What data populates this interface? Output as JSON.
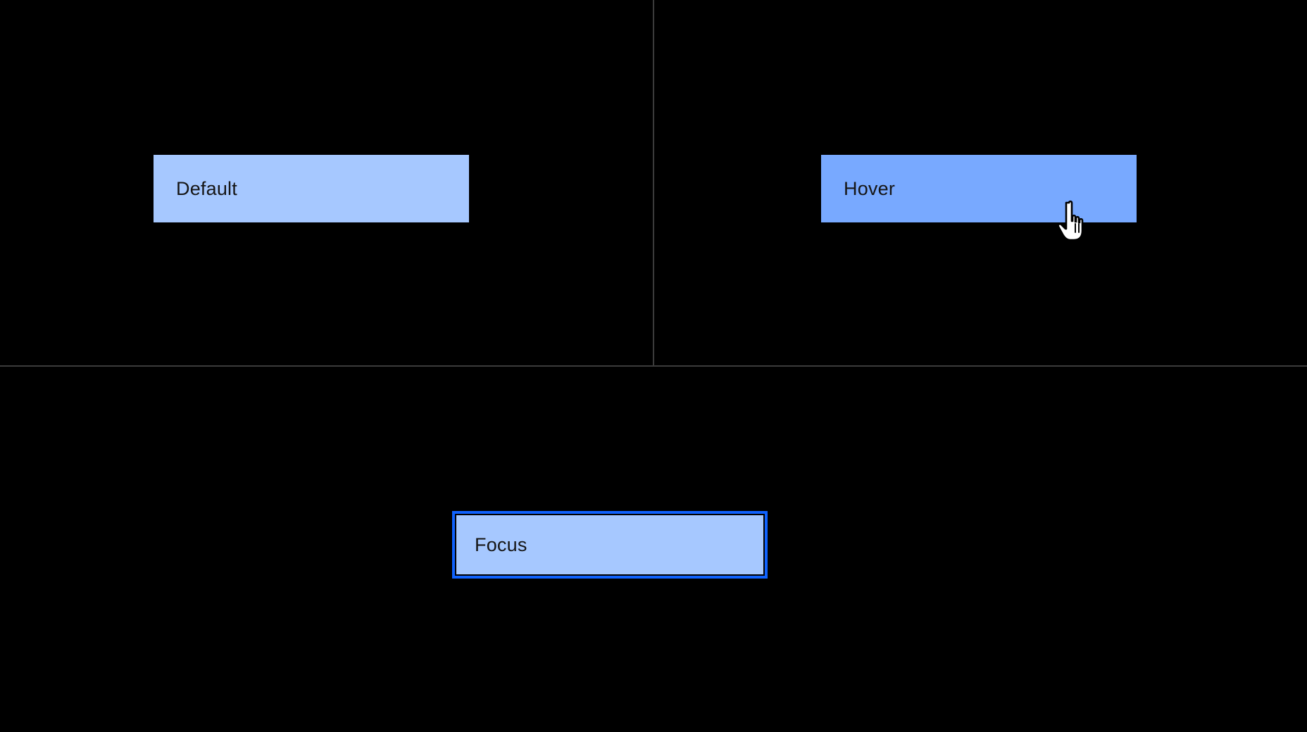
{
  "buttons": {
    "default_label": "Default",
    "hover_label": "Hover",
    "focus_label": "Focus"
  },
  "colors": {
    "background": "#000000",
    "divider": "#3b3b3b",
    "button_default": "#a6c8ff",
    "button_hover": "#78a9ff",
    "focus_ring": "#0f62fe",
    "text": "#161616"
  },
  "icons": {
    "cursor": "hand-pointer-icon"
  }
}
